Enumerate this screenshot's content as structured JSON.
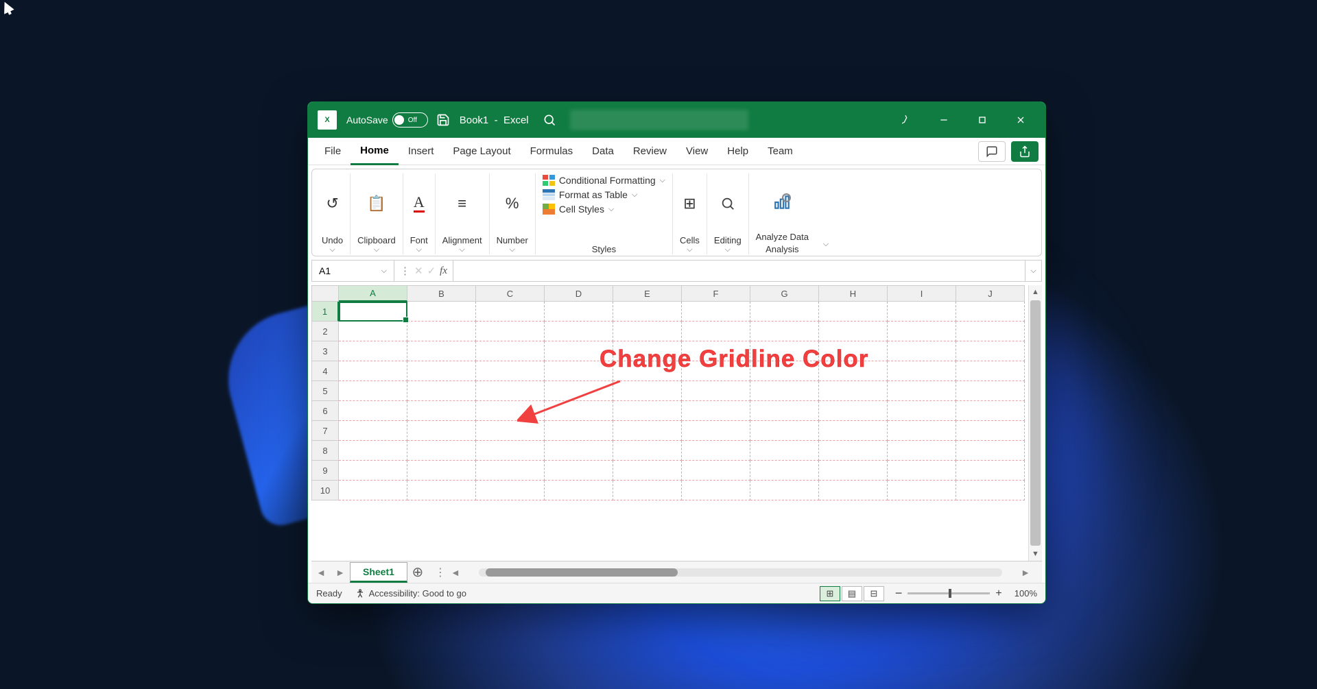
{
  "titlebar": {
    "autosave_label": "AutoSave",
    "autosave_state": "Off",
    "document": "Book1",
    "app": "Excel"
  },
  "tabs": {
    "items": [
      "File",
      "Home",
      "Insert",
      "Page Layout",
      "Formulas",
      "Data",
      "Review",
      "View",
      "Help",
      "Team"
    ],
    "active": "Home"
  },
  "ribbon": {
    "undo": "Undo",
    "clipboard": "Clipboard",
    "font": "Font",
    "alignment": "Alignment",
    "number": "Number",
    "cond_fmt": "Conditional Formatting",
    "fmt_table": "Format as Table",
    "cell_styles": "Cell Styles",
    "styles": "Styles",
    "cells": "Cells",
    "editing": "Editing",
    "analyze": "Analyze Data",
    "analysis": "Analysis"
  },
  "formula": {
    "namebox": "A1",
    "fx": "fx",
    "value": ""
  },
  "grid": {
    "columns": [
      "A",
      "B",
      "C",
      "D",
      "E",
      "F",
      "G",
      "H",
      "I",
      "J"
    ],
    "rows": [
      "1",
      "2",
      "3",
      "4",
      "5",
      "6",
      "7",
      "8",
      "9",
      "10"
    ],
    "active_col": "A",
    "active_row": "1"
  },
  "annotation": "Change Gridline Color",
  "sheets": {
    "active": "Sheet1"
  },
  "status": {
    "ready": "Ready",
    "accessibility": "Accessibility: Good to go",
    "zoom": "100%"
  }
}
